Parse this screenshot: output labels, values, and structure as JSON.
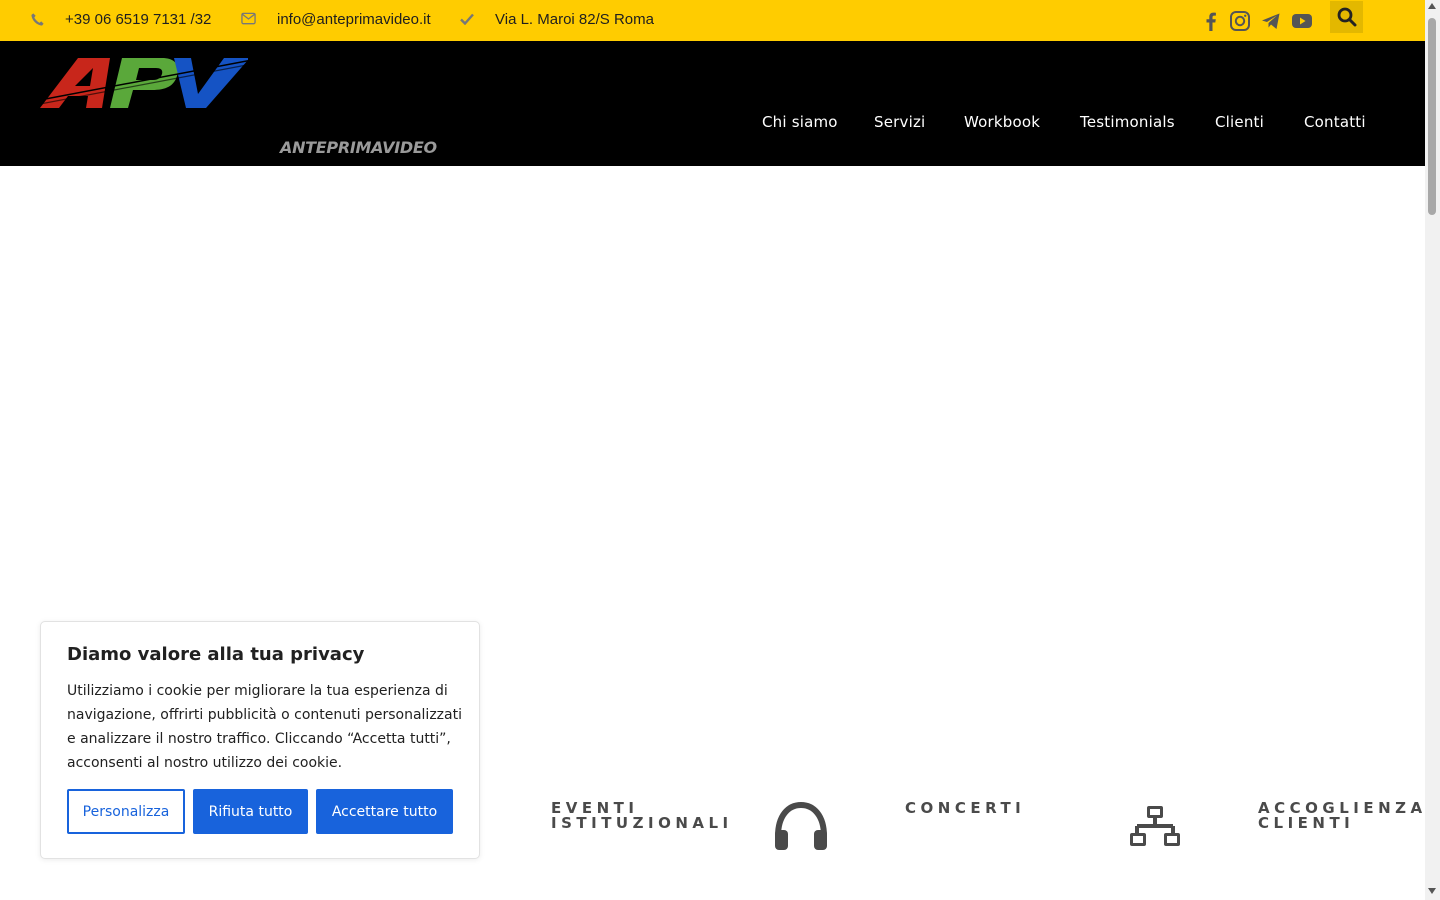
{
  "topbar": {
    "phone": "+39 06 6519 7131 /32",
    "email": "info@anteprimavideo.it",
    "address": "Via L. Maroi 82/S Roma",
    "icons": [
      "phone-icon",
      "envelope-icon",
      "check-icon",
      "facebook-icon",
      "instagram-icon",
      "telegram-icon",
      "youtube-icon",
      "search-icon"
    ]
  },
  "header": {
    "logo_text": "APV",
    "brand_sub": "ANTEPRIMAVIDEO",
    "nav": [
      "Chi siamo",
      "Servizi",
      "Workbook",
      "Testimonials",
      "Clienti",
      "Contatti"
    ]
  },
  "features": [
    {
      "line1": "EVENTI",
      "line2": "ISTITUZIONALI"
    },
    {
      "line1": "CONCERTI",
      "line2": "",
      "icon": "headphones-icon"
    },
    {
      "line1": "ACCOGLIENZA",
      "line2": "CLIENTI",
      "icon": "network-icon"
    }
  ],
  "cookie": {
    "title": "Diamo valore alla tua privacy",
    "text": "Utilizziamo i cookie per migliorare la tua esperienza di navigazione, offrirti pubblicità o contenuti personalizzati e analizzare il nostro traffico. Cliccando “Accetta tutti”, acconsenti al nostro utilizzo dei cookie.",
    "btn_customize": "Personalizza",
    "btn_reject": "Rifiuta tutto",
    "btn_accept": "Accettare tutto"
  },
  "colors": {
    "topbar": "#ffcc00",
    "header": "#000000",
    "button": "#1863dc",
    "logo_red": "#c8261b",
    "logo_green": "#5aa83a",
    "logo_blue": "#1553c4"
  }
}
